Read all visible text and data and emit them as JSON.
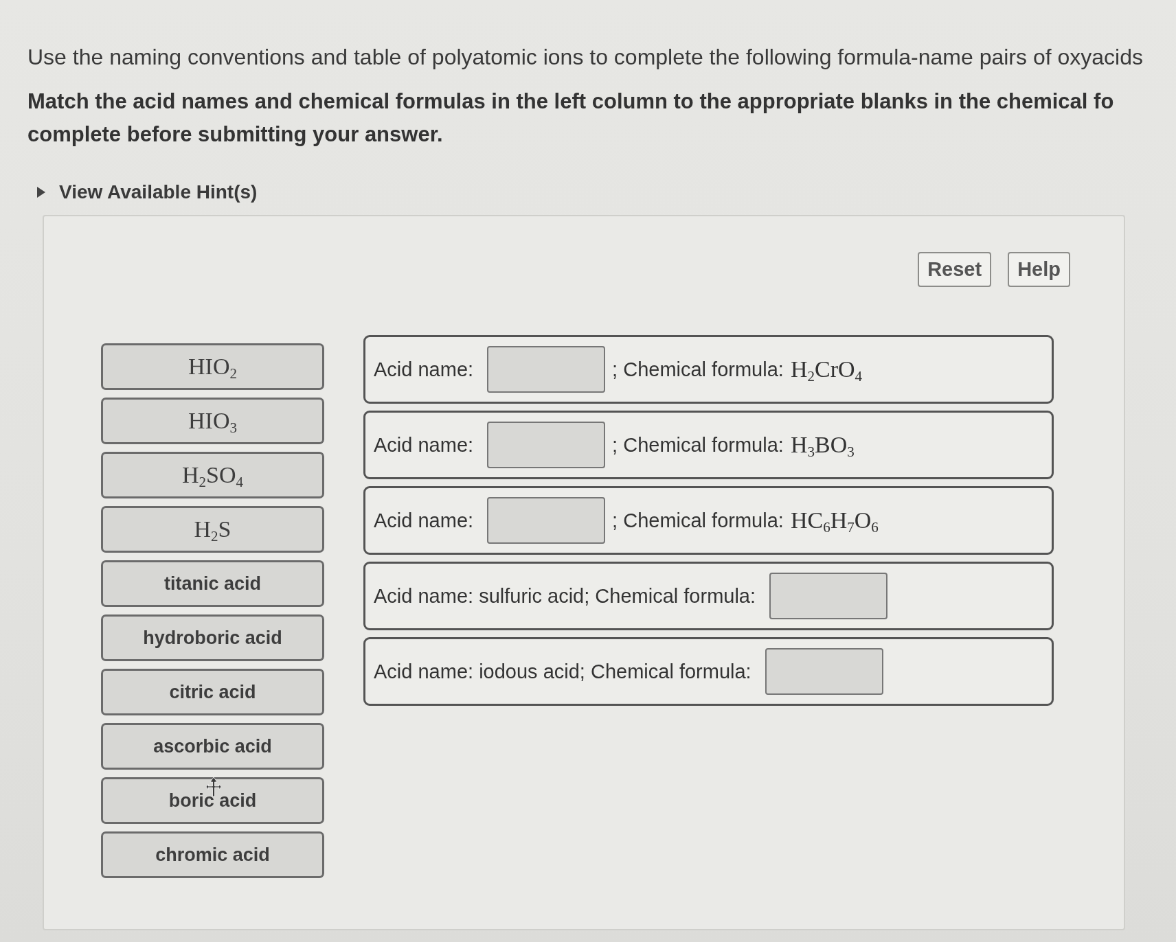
{
  "instructions": {
    "intro": "Use the naming conventions and table of polyatomic ions to complete the following formula-name pairs of oxyacids",
    "task_lines": [
      "Match the acid names and chemical formulas in the left column to the appropriate blanks in the chemical fo",
      "complete before submitting your answer."
    ]
  },
  "hint": {
    "label": "View Available Hint(s)",
    "expanded": false
  },
  "buttons": [
    "Reset",
    "Help"
  ],
  "tiles": [
    {
      "kind": "formula",
      "text": "HIO$_{2}$",
      "hovered": false
    },
    {
      "kind": "formula",
      "text": "HIO$_{3}$",
      "hovered": false
    },
    {
      "kind": "formula",
      "text": "H$_{2}$SO$_{4}$",
      "hovered": false
    },
    {
      "kind": "formula",
      "text": "H$_{2}$S",
      "hovered": false
    },
    {
      "kind": "name",
      "text": "titanic acid",
      "hovered": false
    },
    {
      "kind": "name",
      "text": "hydroboric acid",
      "hovered": false
    },
    {
      "kind": "name",
      "text": "citric acid",
      "hovered": false
    },
    {
      "kind": "name",
      "text": "ascorbic acid",
      "hovered": false
    },
    {
      "kind": "name",
      "text": "boric acid",
      "hovered": true
    },
    {
      "kind": "name",
      "text": "chromic acid",
      "hovered": false
    }
  ],
  "targets": [
    {
      "kind": "name_blank",
      "before": "Acid name:",
      "after": "; Chemical formula:",
      "formula": "H$_{2}$CrO$_{4}$"
    },
    {
      "kind": "name_blank",
      "before": "Acid name:",
      "after": "; Chemical formula:",
      "formula": "H$_{3}$BO$_{3}$"
    },
    {
      "kind": "name_blank",
      "before": "Acid name:",
      "after": "; Chemical formula:",
      "formula": "HC$_{6}$H$_{7}$O$_{6}$"
    },
    {
      "kind": "formula_blank",
      "before": "Acid name: sulfuric acid; Chemical formula:"
    },
    {
      "kind": "formula_blank",
      "before": "Acid name: iodous acid; Chemical formula:"
    }
  ]
}
